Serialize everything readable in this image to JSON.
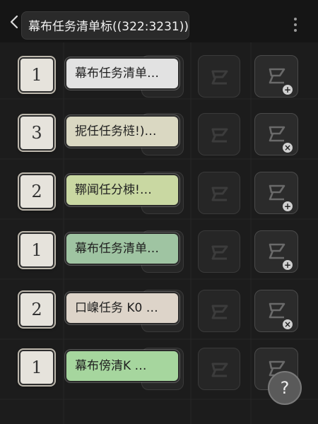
{
  "header": {
    "title": "幕布任务清单标((322:3231))",
    "back_icon": "back-chevron-icon",
    "more_icon": "more-vertical-icon"
  },
  "rows": [
    {
      "number": "1",
      "label": "幕布任务清单…",
      "color": "#e2e2e2",
      "action_icon": "plus"
    },
    {
      "number": "3",
      "label": "抳任任务梿!)…",
      "color": "#dad8c2",
      "action_icon": "close"
    },
    {
      "number": "2",
      "label": "鞹闻任分栜!…",
      "color": "#c9d8a2",
      "action_icon": "plus"
    },
    {
      "number": "1",
      "label": "幕布任务清单…",
      "color": "#9fc4a2",
      "action_icon": "plus"
    },
    {
      "number": "2",
      "label": "口嵲任务 K0 …",
      "color": "#ddd4c9",
      "action_icon": "close"
    },
    {
      "number": "1",
      "label": "幕布傍清K …",
      "color": "#a6d69e",
      "action_icon": "plus"
    }
  ],
  "help": {
    "label": "?"
  },
  "colors": {
    "background": "#1c1c1c",
    "tile": "#262626",
    "number_box": "#e6e3dc"
  }
}
